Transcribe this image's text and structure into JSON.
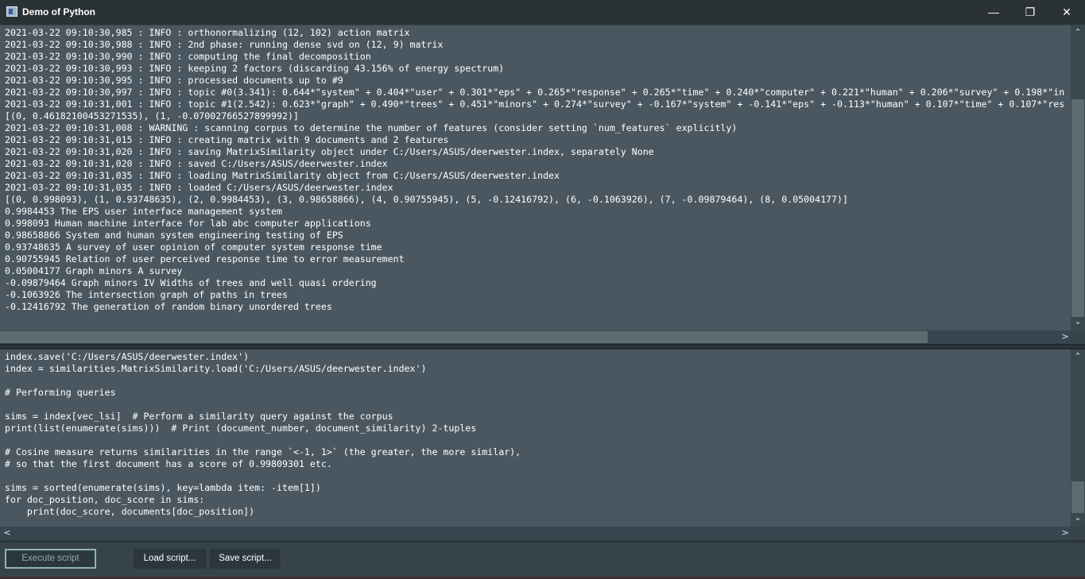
{
  "window": {
    "title": "Demo of Python",
    "minimize": "—",
    "maximize": "❐",
    "close": "✕"
  },
  "output": {
    "lines": [
      "2021-03-22 09:10:30,985 : INFO : orthonormalizing (12, 102) action matrix",
      "2021-03-22 09:10:30,988 : INFO : 2nd phase: running dense svd on (12, 9) matrix",
      "2021-03-22 09:10:30,990 : INFO : computing the final decomposition",
      "2021-03-22 09:10:30,993 : INFO : keeping 2 factors (discarding 43.156% of energy spectrum)",
      "2021-03-22 09:10:30,995 : INFO : processed documents up to #9",
      "2021-03-22 09:10:30,997 : INFO : topic #0(3.341): 0.644*\"system\" + 0.404*\"user\" + 0.301*\"eps\" + 0.265*\"response\" + 0.265*\"time\" + 0.240*\"computer\" + 0.221*\"human\" + 0.206*\"survey\" + 0.198*\"in",
      "2021-03-22 09:10:31,001 : INFO : topic #1(2.542): 0.623*\"graph\" + 0.490*\"trees\" + 0.451*\"minors\" + 0.274*\"survey\" + -0.167*\"system\" + -0.141*\"eps\" + -0.113*\"human\" + 0.107*\"time\" + 0.107*\"res",
      "[(0, 0.46182100453271535), (1, -0.07002766527899992)]",
      "2021-03-22 09:10:31,008 : WARNING : scanning corpus to determine the number of features (consider setting `num_features` explicitly)",
      "2021-03-22 09:10:31,015 : INFO : creating matrix with 9 documents and 2 features",
      "2021-03-22 09:10:31,020 : INFO : saving MatrixSimilarity object under C:/Users/ASUS/deerwester.index, separately None",
      "2021-03-22 09:10:31,020 : INFO : saved C:/Users/ASUS/deerwester.index",
      "2021-03-22 09:10:31,035 : INFO : loading MatrixSimilarity object from C:/Users/ASUS/deerwester.index",
      "2021-03-22 09:10:31,035 : INFO : loaded C:/Users/ASUS/deerwester.index",
      "[(0, 0.998093), (1, 0.93748635), (2, 0.9984453), (3, 0.98658866), (4, 0.90755945), (5, -0.12416792), (6, -0.1063926), (7, -0.09879464), (8, 0.05004177)]",
      "0.9984453 The EPS user interface management system",
      "0.998093 Human machine interface for lab abc computer applications",
      "0.98658866 System and human system engineering testing of EPS",
      "0.93748635 A survey of user opinion of computer system response time",
      "0.90755945 Relation of user perceived response time to error measurement",
      "0.05004177 Graph minors A survey",
      "-0.09879464 Graph minors IV Widths of trees and well quasi ordering",
      "-0.1063926 The intersection graph of paths in trees",
      "-0.12416792 The generation of random binary unordered trees"
    ]
  },
  "script": {
    "lines": [
      "index.save('C:/Users/ASUS/deerwester.index')",
      "index = similarities.MatrixSimilarity.load('C:/Users/ASUS/deerwester.index')",
      "",
      "# Performing queries",
      "",
      "sims = index[vec_lsi]  # Perform a similarity query against the corpus",
      "print(list(enumerate(sims)))  # Print (document_number, document_similarity) 2-tuples",
      "",
      "# Cosine measure returns similarities in the range `<-1, 1>` (the greater, the more similar),",
      "# so that the first document has a score of 0.99809301 etc.",
      "",
      "sims = sorted(enumerate(sims), key=lambda item: -item[1])",
      "for doc_position, doc_score in sims:",
      "    print(doc_score, documents[doc_position])"
    ]
  },
  "scroll": {
    "up": "⌃",
    "down": "⌄",
    "left": "<",
    "right": ">"
  },
  "buttons": {
    "execute": "Execute script",
    "load": "Load script...",
    "save": "Save script..."
  }
}
